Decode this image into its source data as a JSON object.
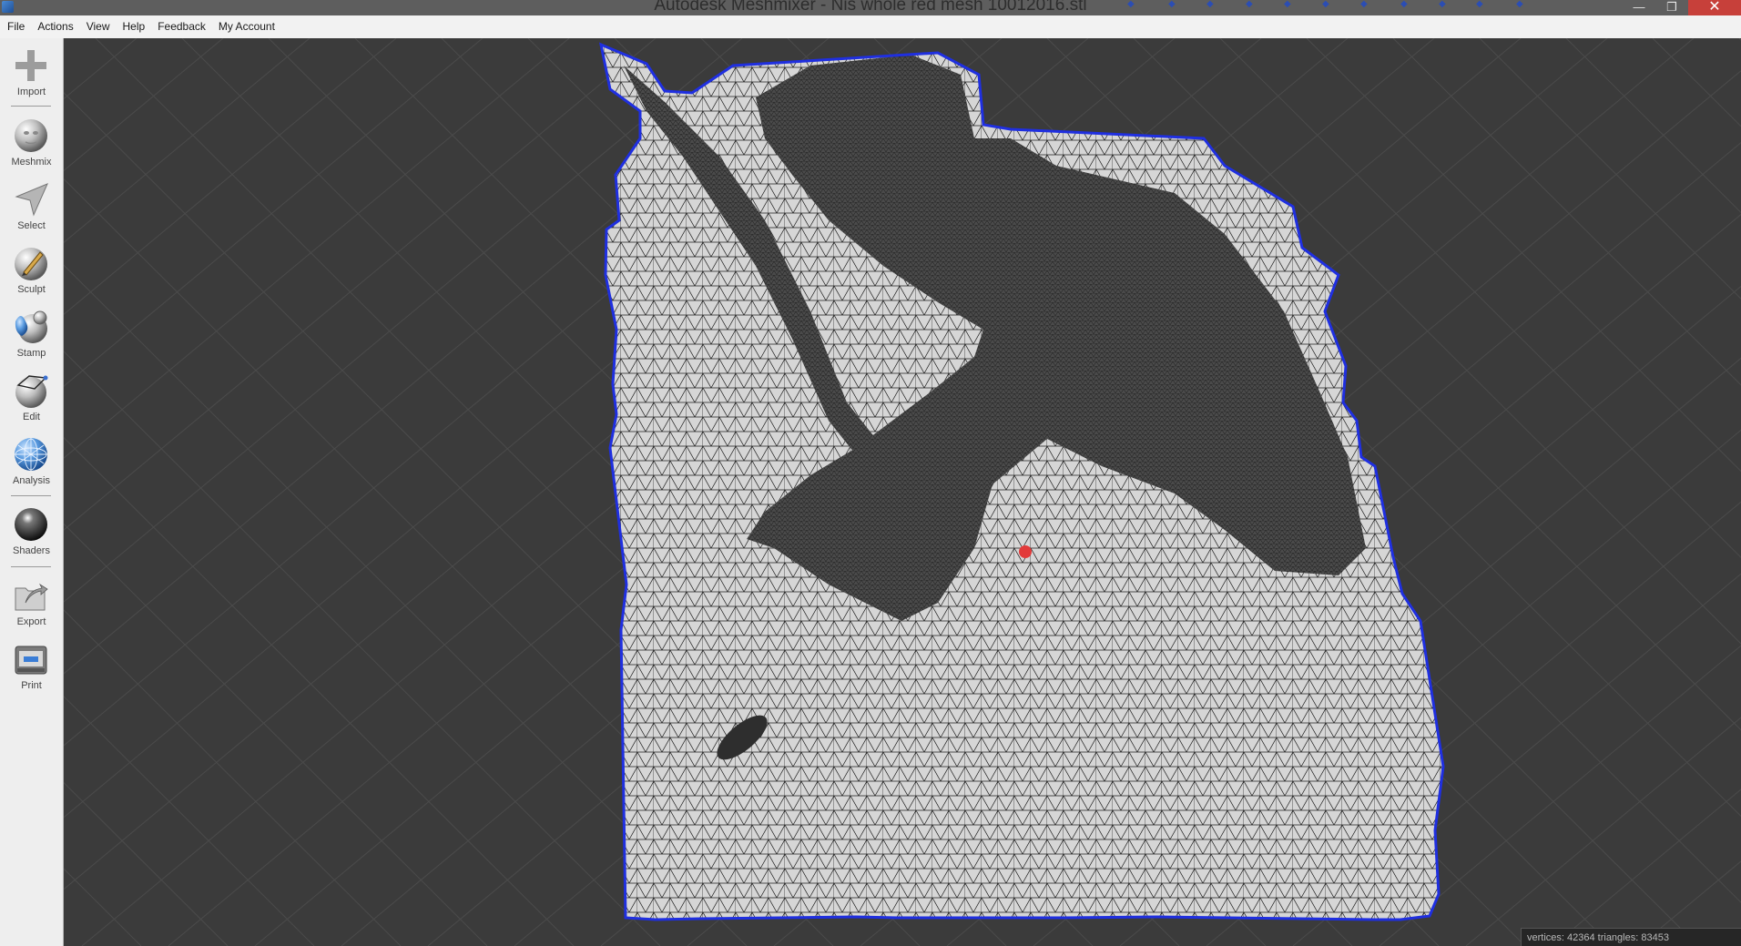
{
  "window": {
    "title": "Autodesk Meshmixer - Nis whole red mesh 10012016.stl",
    "controls": {
      "minimize": "—",
      "restore": "❐",
      "close": "✕"
    }
  },
  "menu": [
    "File",
    "Actions",
    "View",
    "Help",
    "Feedback",
    "My Account"
  ],
  "tools": [
    {
      "label": "Import",
      "icon": "import-plus-icon"
    },
    {
      "label": "Meshmix",
      "icon": "meshmix-head-icon"
    },
    {
      "label": "Select",
      "icon": "select-arrow-icon"
    },
    {
      "label": "Sculpt",
      "icon": "sculpt-brush-icon"
    },
    {
      "label": "Stamp",
      "icon": "stamp-icon"
    },
    {
      "label": "Edit",
      "icon": "edit-sphere-icon"
    },
    {
      "label": "Analysis",
      "icon": "analysis-mesh-icon"
    },
    {
      "label": "Shaders",
      "icon": "shader-sphere-icon"
    },
    {
      "label": "Export",
      "icon": "export-folder-icon"
    },
    {
      "label": "Print",
      "icon": "print-icon"
    }
  ],
  "viewport": {
    "selection_outline_color": "#1f2fe0",
    "pivot_color": "#e23a3a"
  },
  "status": {
    "text": "vertices: 42364 triangles: 83453"
  }
}
